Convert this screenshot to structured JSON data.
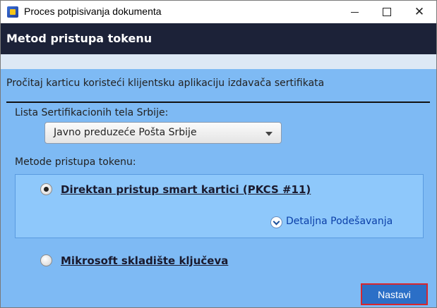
{
  "window": {
    "title": "Proces potpisivanja dokumenta",
    "close_glyph": "✕"
  },
  "header": {
    "title": "Metod pristupa tokenu"
  },
  "content": {
    "instruction": "Pročitaj karticu koristeći klijentsku aplikaciju izdavača sertifikata",
    "cert_list_label": "Lista Sertifikacionih tela Srbije:",
    "cert_select_value": "Javno preduzeće Pošta Srbije",
    "methods_label": "Metode pristupa tokenu:",
    "option1": {
      "label": "Direktan pristup smart kartici (PKCS #11)",
      "selected": true
    },
    "details_link": "Detaljna Podešavanja",
    "option2": {
      "label": "Mikrosoft skladište ključeva",
      "selected": false
    },
    "next_button": "Nastavi"
  },
  "colors": {
    "header_bg": "#1c2238",
    "content_bg": "#7ebaf4",
    "panel_bg": "#8ec8fb",
    "button_bg": "#2b6fc7",
    "button_border": "#d8262c",
    "link": "#0b3fa8"
  },
  "icons": [
    "app-icon",
    "minimize-icon",
    "maximize-icon",
    "close-icon",
    "dropdown-arrow-icon",
    "chevron-down-icon"
  ]
}
